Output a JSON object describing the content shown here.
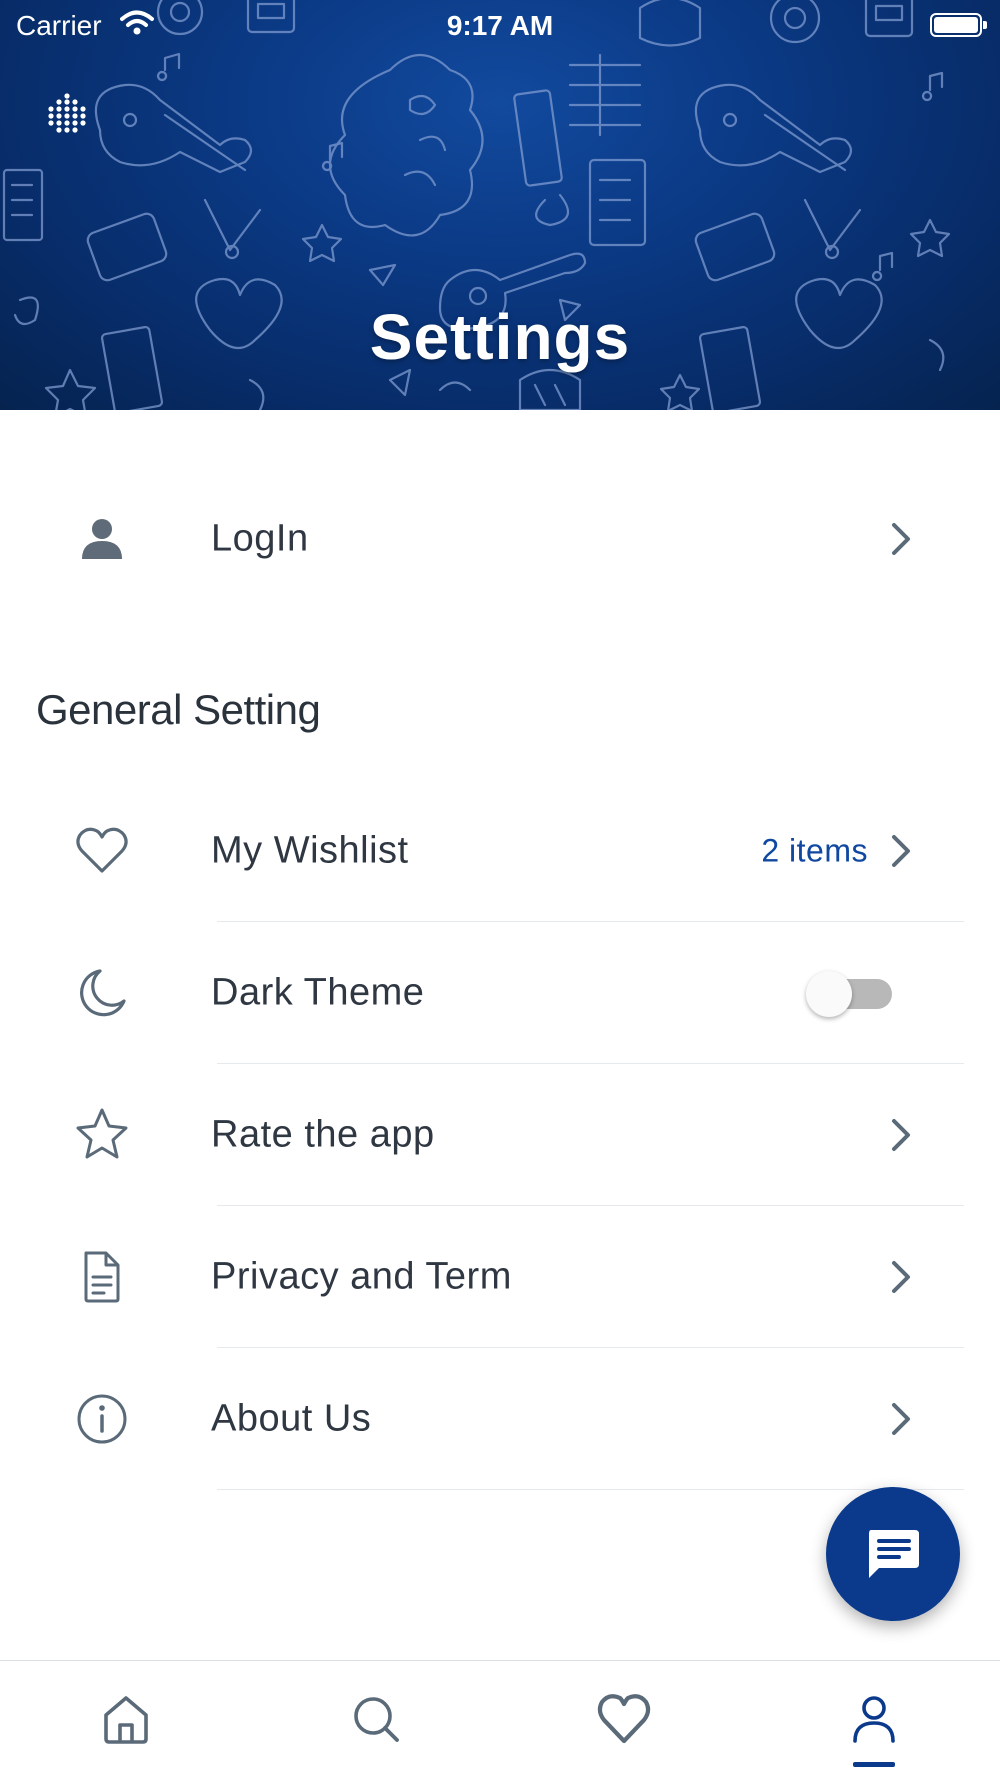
{
  "status_bar": {
    "carrier": "Carrier",
    "time": "9:17 AM"
  },
  "header": {
    "title": "Settings",
    "menu_icon": "dots-grid-icon"
  },
  "login": {
    "label": "LogIn",
    "icon": "person-icon"
  },
  "general": {
    "title": "General Setting",
    "items": [
      {
        "label": "My Wishlist",
        "icon": "heart-icon",
        "meta": "2 items"
      },
      {
        "label": "Dark Theme",
        "icon": "moon-icon",
        "toggle_on": false
      },
      {
        "label": "Rate the app",
        "icon": "star-icon"
      },
      {
        "label": "Privacy and Term",
        "icon": "document-icon"
      },
      {
        "label": "About Us",
        "icon": "info-icon"
      }
    ]
  },
  "fab": {
    "icon": "chat-icon"
  },
  "bottom_nav": {
    "items": [
      "home-icon",
      "search-icon",
      "heart-icon",
      "profile-icon"
    ],
    "active": "profile-icon"
  },
  "colors": {
    "primary": "#0b3a8c",
    "accent_text": "#0f47a1",
    "icon_gray": "#5a6a78",
    "text": "#2f3742"
  }
}
